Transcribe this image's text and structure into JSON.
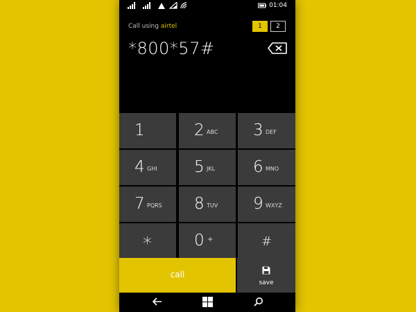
{
  "status_bar": {
    "time": "01:04",
    "icons": [
      "signal-1-icon",
      "signal-2-icon",
      "wifi-triangle-icon",
      "wifi-icon",
      "wireless-icon",
      "battery-icon"
    ]
  },
  "header": {
    "call_using_label": "Call using",
    "carrier": "airtel",
    "sim_buttons": [
      "1",
      "2"
    ],
    "selected_sim": "1"
  },
  "dial_input": {
    "value": "*800*57#"
  },
  "keypad": {
    "keys": [
      {
        "digit": "1",
        "letters": ""
      },
      {
        "digit": "2",
        "letters": "ABC"
      },
      {
        "digit": "3",
        "letters": "DEF"
      },
      {
        "digit": "4",
        "letters": "GHI"
      },
      {
        "digit": "5",
        "letters": "JKL"
      },
      {
        "digit": "6",
        "letters": "MNO"
      },
      {
        "digit": "7",
        "letters": "PQRS"
      },
      {
        "digit": "8",
        "letters": "TUV"
      },
      {
        "digit": "9",
        "letters": "WXYZ"
      },
      {
        "digit": "*",
        "letters": ""
      },
      {
        "digit": "0",
        "letters": "+"
      },
      {
        "digit": "#",
        "letters": ""
      }
    ]
  },
  "actions": {
    "call_label": "call",
    "save_label": "save"
  },
  "colors": {
    "accent": "#e3c400",
    "key_bg": "#3b3b3b",
    "screen_bg": "#000000"
  }
}
